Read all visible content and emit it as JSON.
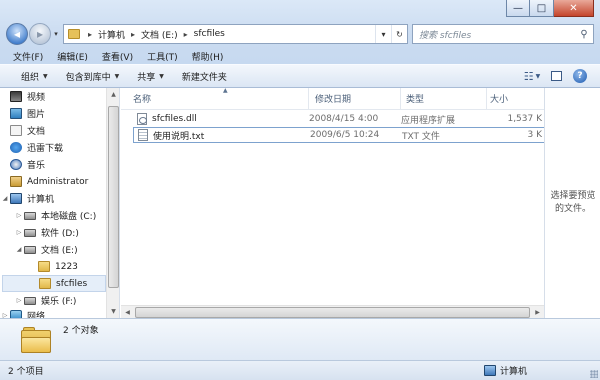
{
  "window": {
    "minimize_glyph": "—",
    "maximize_glyph": "□",
    "close_glyph": "✕"
  },
  "address_bar": {
    "breadcrumbs": [
      "计算机",
      "文档 (E:)",
      "sfcfiles"
    ],
    "separator": "▸",
    "search_placeholder": "搜索 sfcfiles"
  },
  "menu": [
    "文件(F)",
    "编辑(E)",
    "查看(V)",
    "工具(T)",
    "帮助(H)"
  ],
  "toolbar": {
    "organize": "组织",
    "include_in_library": "包含到库中",
    "share": "共享",
    "new_folder": "新建文件夹"
  },
  "nav_pane": {
    "items": [
      {
        "label": "视频",
        "icon": "video-icon"
      },
      {
        "label": "图片",
        "icon": "pictures-icon"
      },
      {
        "label": "文档",
        "icon": "documents-icon"
      },
      {
        "label": "迅雷下载",
        "icon": "thunder-download-icon"
      },
      {
        "label": "音乐",
        "icon": "music-icon"
      },
      {
        "label": "Administrator",
        "icon": "user-folder-icon"
      },
      {
        "label": "计算机",
        "icon": "computer-icon"
      },
      {
        "label": "本地磁盘 (C:)",
        "icon": "drive-icon"
      },
      {
        "label": "软件 (D:)",
        "icon": "drive-icon"
      },
      {
        "label": "文档 (E:)",
        "icon": "drive-icon"
      },
      {
        "label": "1223",
        "icon": "folder-icon"
      },
      {
        "label": "sfcfiles",
        "icon": "folder-icon"
      },
      {
        "label": "娱乐 (F:)",
        "icon": "drive-icon"
      },
      {
        "label": "网络",
        "icon": "network-icon"
      }
    ]
  },
  "file_list": {
    "columns": [
      "名称",
      "修改日期",
      "类型",
      "大小"
    ],
    "rows": [
      {
        "name": "sfcfiles.dll",
        "date": "2008/4/15 4:00",
        "type": "应用程序扩展",
        "size": "1,537 K",
        "icon": "dll-file-icon"
      },
      {
        "name": "使用说明.txt",
        "date": "2009/6/5 10:24",
        "type": "TXT 文件",
        "size": "3 K",
        "icon": "text-file-icon"
      }
    ]
  },
  "preview_pane": {
    "line1": "选择要预览",
    "line2": "的文件。"
  },
  "details_pane": {
    "summary": "2 个对象"
  },
  "status_bar": {
    "item_count": "2 个项目",
    "location": "计算机"
  }
}
